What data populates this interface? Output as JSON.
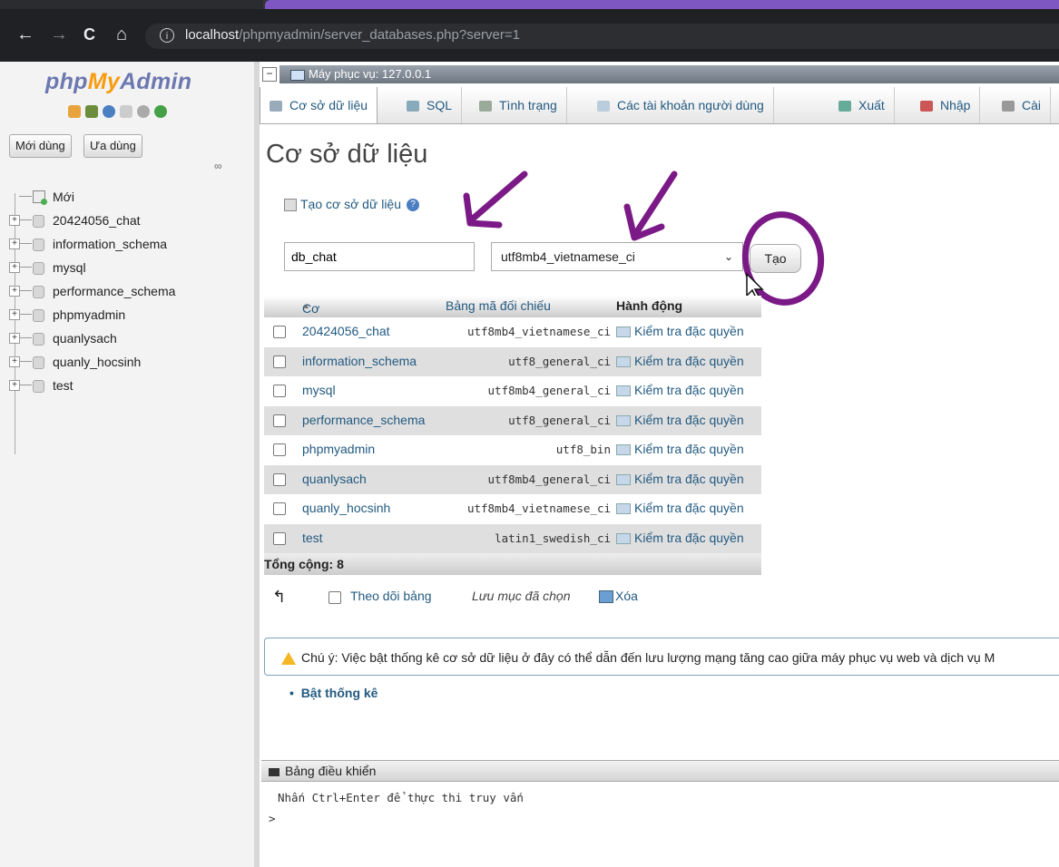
{
  "browser": {
    "url_host": "localhost",
    "url_path": "/phpmyadmin/server_databases.php?server=1"
  },
  "sidebar": {
    "logo": {
      "part1": "php",
      "part2": "My",
      "part3": "Admin"
    },
    "recent_label": "Mới dùng",
    "favorites_label": "Ưa dùng",
    "tree": [
      {
        "label": "Mới",
        "type": "new"
      },
      {
        "label": "20424056_chat",
        "type": "db"
      },
      {
        "label": "information_schema",
        "type": "db"
      },
      {
        "label": "mysql",
        "type": "db"
      },
      {
        "label": "performance_schema",
        "type": "db"
      },
      {
        "label": "phpmyadmin",
        "type": "db"
      },
      {
        "label": "quanlysach",
        "type": "db"
      },
      {
        "label": "quanly_hocsinh",
        "type": "db"
      },
      {
        "label": "test",
        "type": "db"
      }
    ]
  },
  "server": {
    "label": "Máy phục vụ: 127.0.0.1"
  },
  "nav": {
    "tabs": [
      {
        "label": "Cơ sở dữ liệu",
        "icon": "database-icon"
      },
      {
        "label": "SQL",
        "icon": "sql-icon"
      },
      {
        "label": "Tình trạng",
        "icon": "status-icon"
      },
      {
        "label": "Các tài khoản người dùng",
        "icon": "users-icon"
      },
      {
        "label": "Xuất",
        "icon": "export-icon"
      },
      {
        "label": "Nhập",
        "icon": "import-icon"
      },
      {
        "label": "Cài",
        "icon": "settings-icon"
      }
    ]
  },
  "page": {
    "title": "Cơ sở dữ liệu",
    "create_label": "Tạo cơ sở dữ liệu",
    "db_name_value": "db_chat",
    "collation_value": "utf8mb4_vietnamese_ci",
    "create_button": "Tạo"
  },
  "table": {
    "headers": {
      "db": "Cơ sở dữ liệu",
      "collation": "Bảng mã đối chiếu",
      "action": "Hành động"
    },
    "rows": [
      {
        "name": "20424056_chat",
        "collation": "utf8mb4_vietnamese_ci",
        "action": "Kiểm tra đặc quyền"
      },
      {
        "name": "information_schema",
        "collation": "utf8_general_ci",
        "action": "Kiểm tra đặc quyền"
      },
      {
        "name": "mysql",
        "collation": "utf8mb4_general_ci",
        "action": "Kiểm tra đặc quyền"
      },
      {
        "name": "performance_schema",
        "collation": "utf8_general_ci",
        "action": "Kiểm tra đặc quyền"
      },
      {
        "name": "phpmyadmin",
        "collation": "utf8_bin",
        "action": "Kiểm tra đặc quyền"
      },
      {
        "name": "quanlysach",
        "collation": "utf8mb4_general_ci",
        "action": "Kiểm tra đặc quyền"
      },
      {
        "name": "quanly_hocsinh",
        "collation": "utf8mb4_vietnamese_ci",
        "action": "Kiểm tra đặc quyền"
      },
      {
        "name": "test",
        "collation": "latin1_swedish_ci",
        "action": "Kiểm tra đặc quyền"
      }
    ],
    "total": "Tổng cộng: 8"
  },
  "bulk": {
    "check_all": "Theo dõi bảng",
    "with_selected": "Lưu mục đã chọn",
    "delete": "Xóa"
  },
  "notice": {
    "text": "Chú ý: Việc bật thống kê cơ sở dữ liệu ở đây có thể dẫn đến lưu lượng mạng tăng cao giữa máy phục vụ web và dịch vụ M",
    "enable_stats": "Bật thống kê"
  },
  "console": {
    "title": "Bảng điều khiển",
    "hint": "Nhấn Ctrl+Enter để thực thi truy vấn",
    "prompt": ">"
  },
  "colors": {
    "annotation": "#7b1a86",
    "link": "#235a81",
    "logo_blue": "#6c78af",
    "logo_orange": "#f89c0e"
  }
}
